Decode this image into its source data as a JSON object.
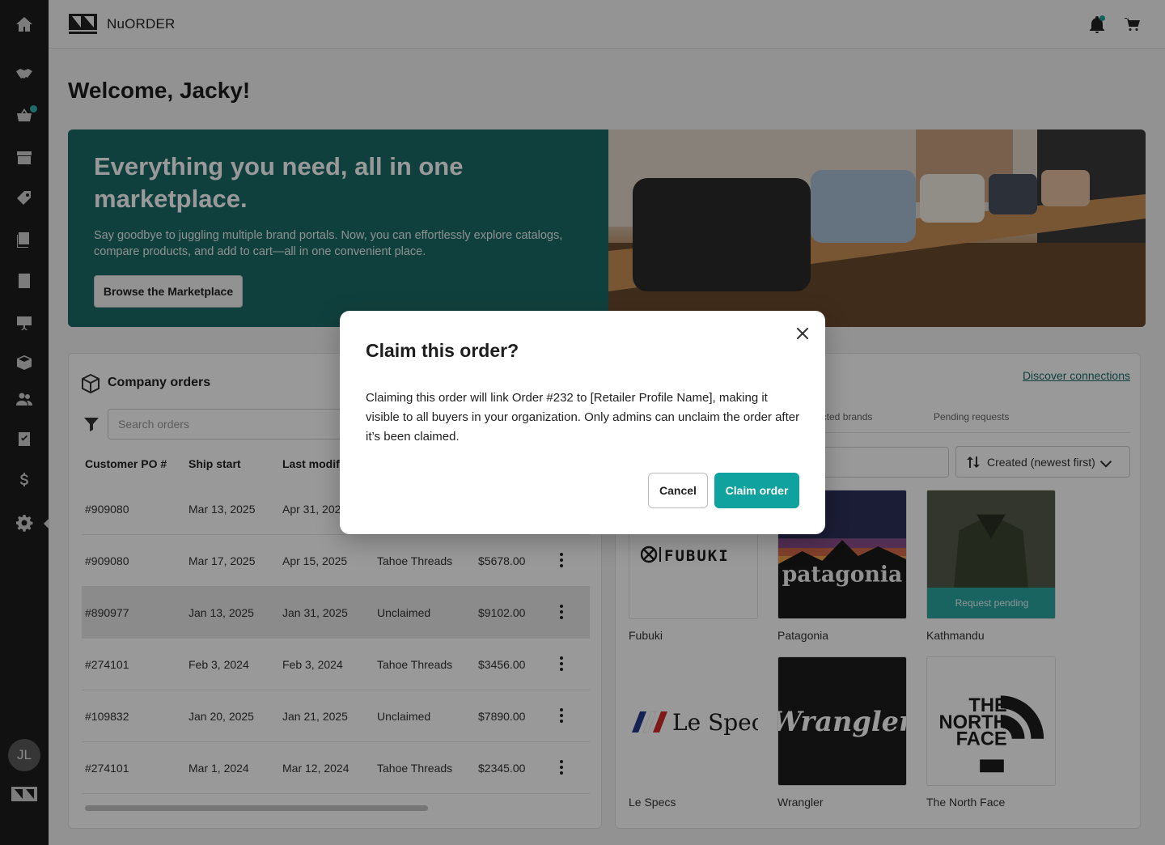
{
  "app": {
    "name": "NuORDER",
    "logo_text": "NuORDER"
  },
  "sidebar": {
    "items": [
      {
        "name": "home-icon"
      },
      {
        "name": "handshake-icon"
      },
      {
        "name": "basket-icon",
        "badge": true
      },
      {
        "name": "storefront-icon"
      },
      {
        "name": "tag-icon"
      },
      {
        "name": "catalog-icon"
      },
      {
        "name": "orders-list-icon"
      },
      {
        "name": "presentation-icon"
      },
      {
        "name": "box-icon"
      },
      {
        "name": "users-icon"
      },
      {
        "name": "checklist-icon"
      },
      {
        "name": "dollar-icon"
      },
      {
        "name": "settings-gear-icon"
      }
    ],
    "avatar_initials": "JL"
  },
  "header": {
    "icons": [
      "bell-icon",
      "cart-icon"
    ]
  },
  "welcome": "Welcome, Jacky!",
  "hero": {
    "title": "Everything you need, all in one marketplace.",
    "subtitle": "Say goodbye to juggling multiple brand portals. Now, you can effortlessly explore catalogs, compare products, and add to cart—all in one convenient place.",
    "button": "Browse the Marketplace"
  },
  "company_orders": {
    "title": "Company orders",
    "search_placeholder": "Search orders",
    "columns": [
      "Customer PO #",
      "Ship start",
      "Last modifie"
    ],
    "rows": [
      {
        "po": "#909080",
        "ship": "Mar 13, 2025",
        "modified": "Apr 31, 202",
        "retailer": "",
        "total": ""
      },
      {
        "po": "#909080",
        "ship": "Mar 17, 2025",
        "modified": "Apr 15, 2025",
        "retailer": "Tahoe Threads",
        "total": "$5678.00"
      },
      {
        "po": "#890977",
        "ship": "Jan 13, 2025",
        "modified": "Jan 31, 2025",
        "retailer": "Unclaimed",
        "total": "$9102.00"
      },
      {
        "po": "#274101",
        "ship": "Feb 3, 2024",
        "modified": "Feb 3, 2024",
        "retailer": "Tahoe Threads",
        "total": "$3456.00"
      },
      {
        "po": "#109832",
        "ship": "Jan 20, 2025",
        "modified": "Jan 21, 2025",
        "retailer": "Unclaimed",
        "total": "$7890.00"
      },
      {
        "po": "#274101",
        "ship": "Mar 1, 2024",
        "modified": "Mar 12, 2024",
        "retailer": "Tahoe Threads",
        "total": "$2345.00"
      }
    ]
  },
  "connections": {
    "discover_link": "Discover connections",
    "tabs": [
      "ected brands",
      "Pending requests"
    ],
    "sort": "Created (newest first)",
    "brands": [
      {
        "name": "Fubuki",
        "logo": "FUBUKI"
      },
      {
        "name": "Patagonia",
        "logo": "patagonia"
      },
      {
        "name": "Kathmandu",
        "status": "Request pending"
      },
      {
        "name": "Le Specs",
        "logo": "Le Specs"
      },
      {
        "name": "Wrangler",
        "logo": "Wrangler"
      },
      {
        "name": "The North Face",
        "logo_line1": "THE",
        "logo_line2": "NORTH",
        "logo_line3": "FACE"
      }
    ]
  },
  "modal": {
    "title": "Claim this order?",
    "body": "Claiming this order will link Order #232 to [Retailer Profile Name], making it visible to all buyers in your organization. Only admins can unclaim the order after it’s been claimed.",
    "cancel": "Cancel",
    "confirm": "Claim order"
  },
  "colors": {
    "accent": "#0fa29f",
    "hero_bg": "#1b6b66",
    "sidebar_bg": "#1d1d1d"
  }
}
